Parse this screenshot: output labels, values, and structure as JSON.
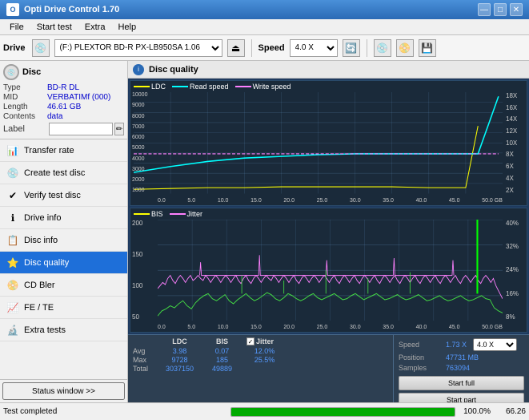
{
  "titleBar": {
    "title": "Opti Drive Control 1.70",
    "minBtn": "—",
    "maxBtn": "□",
    "closeBtn": "✕"
  },
  "menuBar": {
    "items": [
      "File",
      "Start test",
      "Extra",
      "Help"
    ]
  },
  "toolbar": {
    "driveLabel": "Drive",
    "driveValue": "(F:) PLEXTOR BD-R  PX-LB950SA 1.06",
    "speedLabel": "Speed",
    "speedValue": "4.0 X"
  },
  "discInfo": {
    "type": {
      "label": "Type",
      "value": "BD-R DL"
    },
    "mid": {
      "label": "MID",
      "value": "VERBATIMf (000)"
    },
    "length": {
      "label": "Length",
      "value": "46.61 GB"
    },
    "contents": {
      "label": "Contents",
      "value": "data"
    },
    "label": {
      "label": "Label",
      "value": ""
    }
  },
  "navMenu": {
    "items": [
      {
        "id": "transfer-rate",
        "label": "Transfer rate",
        "icon": "📊"
      },
      {
        "id": "create-test-disc",
        "label": "Create test disc",
        "icon": "💿"
      },
      {
        "id": "verify-test-disc",
        "label": "Verify test disc",
        "icon": "✔"
      },
      {
        "id": "drive-info",
        "label": "Drive info",
        "icon": "ℹ"
      },
      {
        "id": "disc-info",
        "label": "Disc info",
        "icon": "📋"
      },
      {
        "id": "disc-quality",
        "label": "Disc quality",
        "icon": "⭐",
        "active": true
      },
      {
        "id": "cd-bler",
        "label": "CD Bler",
        "icon": "📀"
      },
      {
        "id": "fe-te",
        "label": "FE / TE",
        "icon": "📈"
      },
      {
        "id": "extra-tests",
        "label": "Extra tests",
        "icon": "🔬"
      }
    ],
    "statusBtn": "Status window >>"
  },
  "chartArea": {
    "title": "Disc quality",
    "topChart": {
      "legend": [
        {
          "label": "LDC",
          "color": "#ffff00"
        },
        {
          "label": "Read speed",
          "color": "#00ffff"
        },
        {
          "label": "Write speed",
          "color": "#ff00ff"
        }
      ],
      "yAxisLabels": [
        "18X",
        "16X",
        "14X",
        "12X",
        "10X",
        "8X",
        "6X",
        "4X",
        "2X"
      ],
      "yValLabels": [
        "10000",
        "9000",
        "8000",
        "7000",
        "6000",
        "5000",
        "4000",
        "3000",
        "2000",
        "1000"
      ],
      "xAxisLabels": [
        "0.0",
        "5.0",
        "10.0",
        "15.0",
        "20.0",
        "25.0",
        "30.0",
        "35.0",
        "40.0",
        "45.0",
        "50.0 GB"
      ]
    },
    "bottomChart": {
      "legend": [
        {
          "label": "BIS",
          "color": "#ffff00"
        },
        {
          "label": "Jitter",
          "color": "#ff00ff"
        }
      ],
      "yAxisLabels": [
        "40%",
        "32%",
        "24%",
        "16%",
        "8%"
      ],
      "yValLabels": [
        "200",
        "150",
        "100",
        "50"
      ],
      "xAxisLabels": [
        "0.0",
        "5.0",
        "10.0",
        "15.0",
        "20.0",
        "25.0",
        "30.0",
        "35.0",
        "40.0",
        "45.0",
        "50.0 GB"
      ]
    }
  },
  "statsArea": {
    "columns": {
      "headers": [
        "LDC",
        "BIS",
        "",
        "Jitter",
        "Speed",
        ""
      ],
      "checkJitter": "☑",
      "rows": [
        {
          "label": "Avg",
          "ldc": "3.98",
          "bis": "0.07",
          "jitter": "12.0%",
          "speed1": "1.73 X",
          "speed2": "4.0 X"
        },
        {
          "label": "Max",
          "ldc": "9728",
          "bis": "185",
          "jitter": "25.5%",
          "position_label": "Position",
          "position_val": "47731 MB"
        },
        {
          "label": "Total",
          "ldc": "3037150",
          "bis": "49889",
          "samples_label": "Samples",
          "samples_val": "763094"
        }
      ]
    },
    "buttons": {
      "startFull": "Start full",
      "startPart": "Start part"
    }
  },
  "statusBar": {
    "text": "Test completed",
    "progress": 100,
    "progressText": "100.0%",
    "rightText": "66.26"
  }
}
